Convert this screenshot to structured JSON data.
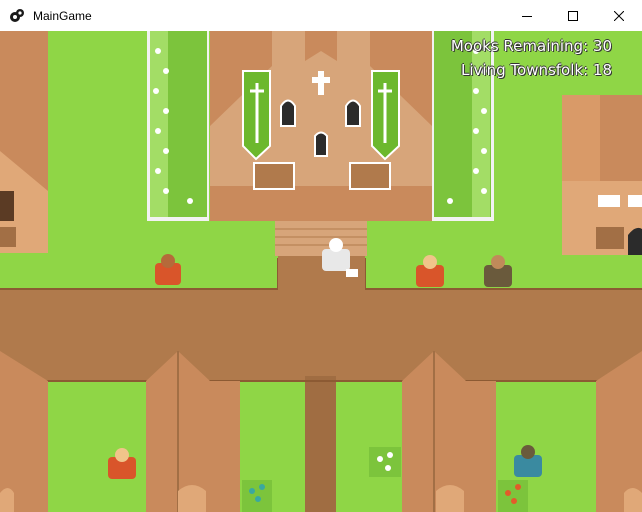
{
  "window": {
    "title": "MainGame",
    "icon": "game-controller-icon",
    "controls": [
      "minimize-icon",
      "maximize-icon",
      "close-icon"
    ]
  },
  "hud": {
    "mooks_remaining": "Mooks Remaining: 30",
    "living_townsfolk": "Living Townsfolk: 18"
  },
  "colors": {
    "grass": "#8fd646",
    "dirt": "#b07a4c",
    "roof": "#c98a5c",
    "hud_text": "#ffffff"
  }
}
